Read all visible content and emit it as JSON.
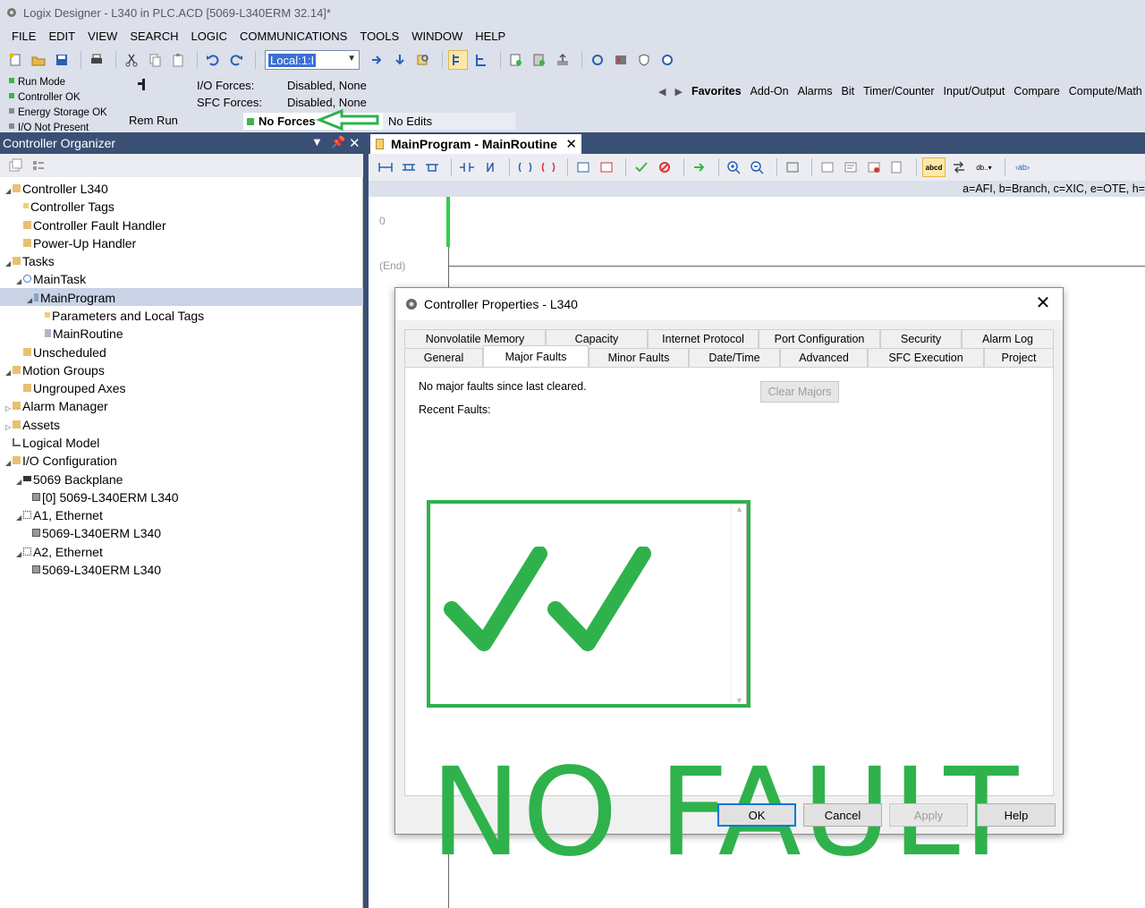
{
  "window": {
    "title": "Logix Designer - L340 in PLC.ACD [5069-L340ERM 32.14]*"
  },
  "menu": [
    "FILE",
    "EDIT",
    "VIEW",
    "SEARCH",
    "LOGIC",
    "COMMUNICATIONS",
    "TOOLS",
    "WINDOW",
    "HELP"
  ],
  "toolbar": {
    "path_value": "Local:1:I"
  },
  "status": {
    "run_mode": "Run Mode",
    "controller_ok": "Controller OK",
    "energy_storage": "Energy Storage OK",
    "io_not_present": "I/O Not Present",
    "rem_run": "Rem Run",
    "no_forces": "No Forces",
    "no_edits": "No Edits",
    "io_forces_label": "I/O Forces:",
    "io_forces_value": "Disabled, None",
    "sfc_forces_label": "SFC Forces:",
    "sfc_forces_value": "Disabled, None"
  },
  "instruction_tabs": [
    "Favorites",
    "Add-On",
    "Alarms",
    "Bit",
    "Timer/Counter",
    "Input/Output",
    "Compare",
    "Compute/Math"
  ],
  "organizer": {
    "title": "Controller Organizer",
    "tree": [
      "Controller L340",
      "Controller Tags",
      "Controller Fault Handler",
      "Power-Up Handler",
      "Tasks",
      "MainTask",
      "MainProgram",
      "Parameters and Local Tags",
      "MainRoutine",
      "Unscheduled",
      "Motion Groups",
      "Ungrouped Axes",
      "Alarm Manager",
      "Assets",
      "Logical Model",
      "I/O Configuration",
      "5069 Backplane",
      "[0] 5069-L340ERM L340",
      "A1, Ethernet",
      "5069-L340ERM L340",
      "A2, Ethernet",
      "5069-L340ERM L340"
    ]
  },
  "routine": {
    "tab_title": "MainProgram - MainRoutine",
    "legend": "a=AFI, b=Branch, c=XIC, e=OTE, h=",
    "rung_number": "0",
    "end_label": "(End)"
  },
  "dialog": {
    "title": "Controller Properties - L340",
    "tabs_row1": [
      "Nonvolatile Memory",
      "Capacity",
      "Internet Protocol",
      "Port Configuration",
      "Security",
      "Alarm Log"
    ],
    "tabs_row2": [
      "General",
      "Major Faults",
      "Minor Faults",
      "Date/Time",
      "Advanced",
      "SFC Execution",
      "Project"
    ],
    "active_tab": "Major Faults",
    "message": "No major faults since last cleared.",
    "clear_button": "Clear Majors",
    "recent_label": "Recent Faults:",
    "annotation": "NO FAULT",
    "buttons": {
      "ok": "OK",
      "cancel": "Cancel",
      "apply": "Apply",
      "help": "Help"
    }
  },
  "colors": {
    "annotation_green": "#2fb24c",
    "header_blue": "#3a4f74"
  }
}
